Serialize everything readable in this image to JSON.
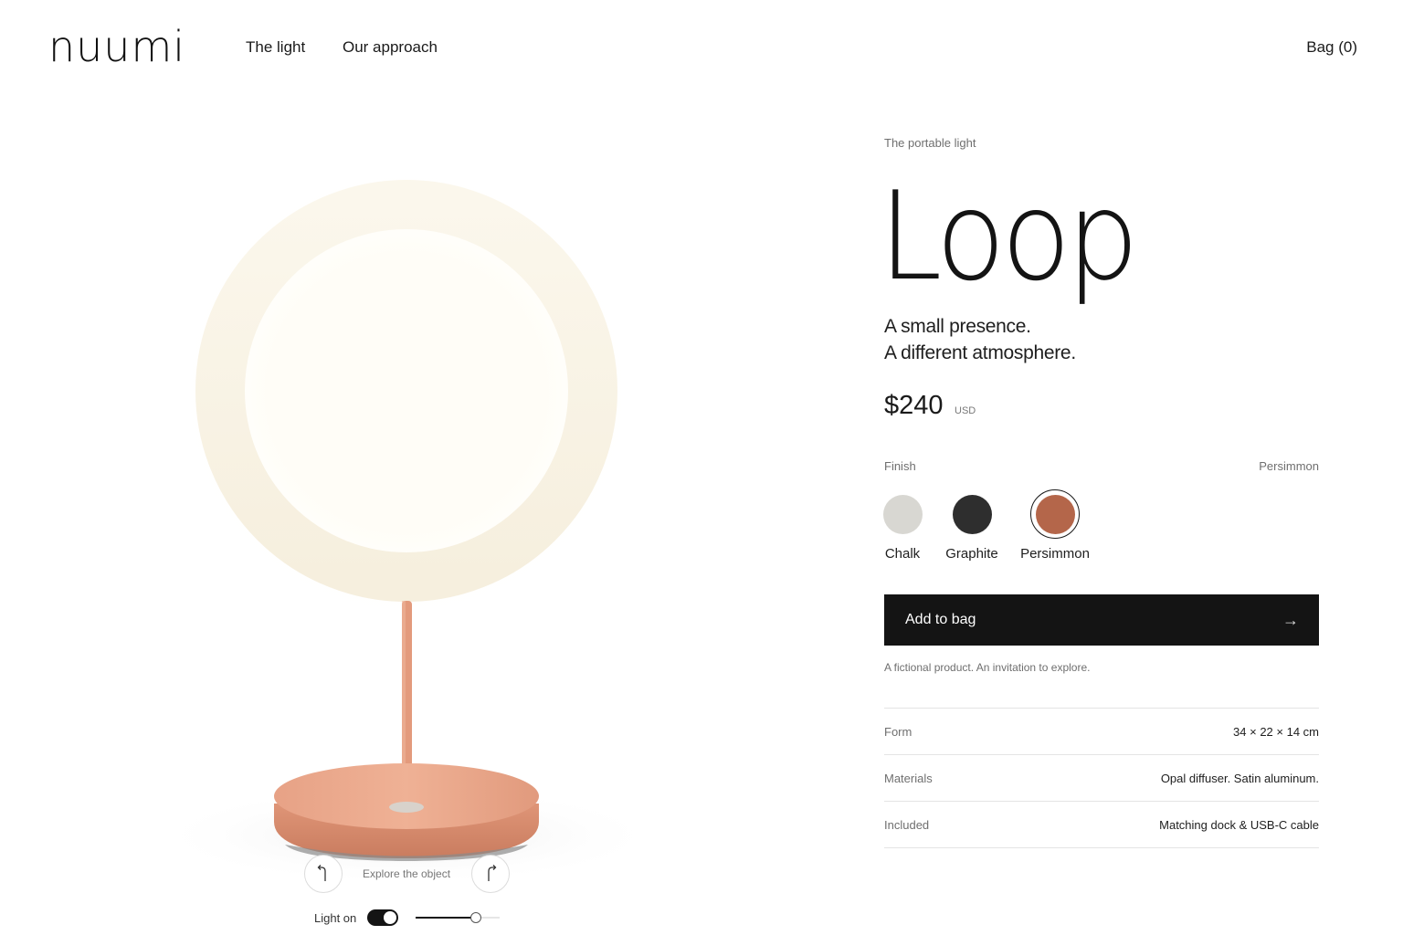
{
  "header": {
    "logo": "nuumi",
    "nav": [
      "The light",
      "Our approach"
    ],
    "bag": "Bag (0)"
  },
  "stage": {
    "explore_label": "Explore the object",
    "light_label": "Light on",
    "light_on": true,
    "brightness": 0.72
  },
  "product": {
    "eyebrow": "The portable light",
    "name": "Loop",
    "tagline_1": "A small presence.",
    "tagline_2": "A different atmosphere.",
    "price": "$240",
    "currency": "USD"
  },
  "finish": {
    "label": "Finish",
    "selected": "Persimmon",
    "options": [
      {
        "name": "Chalk",
        "color": "#d8d7d2"
      },
      {
        "name": "Graphite",
        "color": "#2e2e2e"
      },
      {
        "name": "Persimmon",
        "color": "#b4664a"
      }
    ]
  },
  "cta": {
    "label": "Add to bag",
    "arrow": "→"
  },
  "disclaimer": "A fictional product. An invitation to explore.",
  "specs": [
    {
      "key": "Form",
      "value": "34 × 22 × 14 cm"
    },
    {
      "key": "Materials",
      "value": "Opal diffuser. Satin aluminum."
    },
    {
      "key": "Included",
      "value": "Matching dock & USB-C cable"
    }
  ],
  "colors": {
    "accent": "#141414",
    "lamp_body": "#e39a7c",
    "diffuser": "#fbf7ee"
  }
}
